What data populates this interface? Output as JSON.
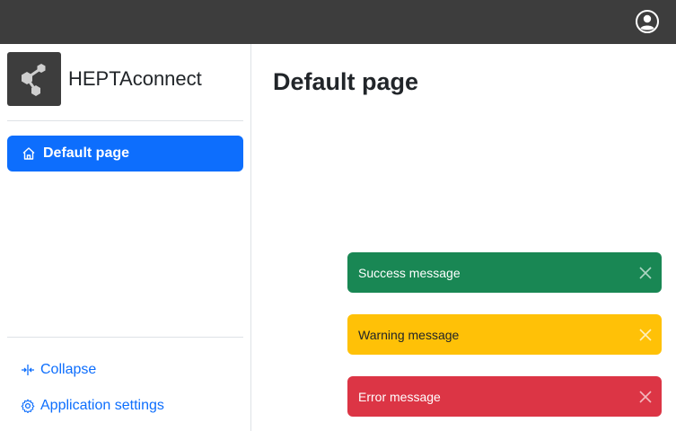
{
  "topbar": {
    "user_icon": "user-circle-icon"
  },
  "brand": {
    "name": "HEPTAconnect",
    "logo_icon": "network-nodes-icon"
  },
  "nav": {
    "items": [
      {
        "label": "Default page",
        "icon": "home-icon",
        "active": true
      }
    ]
  },
  "sidebar_footer": {
    "collapse_label": "Collapse",
    "settings_label": "Application settings"
  },
  "main": {
    "title": "Default page"
  },
  "toasts": [
    {
      "type": "success",
      "message": "Success message",
      "color": "#198754"
    },
    {
      "type": "warning",
      "message": "Warning message",
      "color": "#ffc107"
    },
    {
      "type": "error",
      "message": "Error message",
      "color": "#dc3545"
    }
  ],
  "colors": {
    "topbar": "#3d3d3d",
    "primary": "#0d6efd"
  }
}
